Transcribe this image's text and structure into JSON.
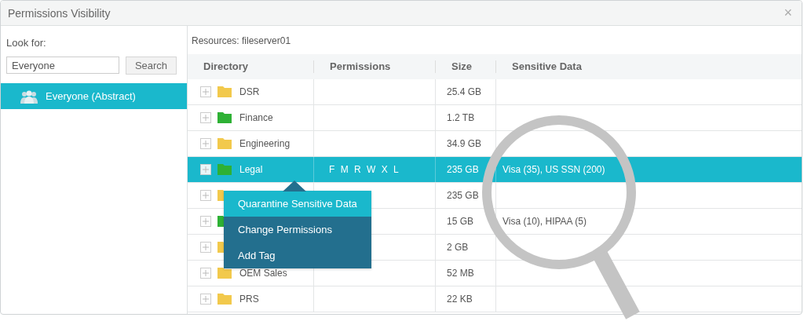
{
  "window": {
    "title": "Permissions Visibility",
    "close": "×"
  },
  "sidebar": {
    "label": "Look for:",
    "search_value": "Everyone",
    "search_button": "Search",
    "items": [
      {
        "label": "Everyone (Abstract)",
        "selected": true
      }
    ]
  },
  "resources": "Resources: fileserver01",
  "table": {
    "columns": [
      "Directory",
      "Permissions",
      "Size",
      "Sensitive Data"
    ],
    "rows": [
      {
        "name": "DSR",
        "color": "#f2c94c",
        "permissions": "",
        "size": "25.4 GB",
        "sensitive": "",
        "selected": false
      },
      {
        "name": "Finance",
        "color": "#2eb135",
        "permissions": "",
        "size": "1.2 TB",
        "sensitive": "",
        "selected": false
      },
      {
        "name": "Engineering",
        "color": "#f2c94c",
        "permissions": "",
        "size": "34.9 GB",
        "sensitive": "",
        "selected": false
      },
      {
        "name": "Legal",
        "color": "#2eb135",
        "permissions": "F M R W X L",
        "size": "235 GB",
        "sensitive": "Visa (35), US SSN (200)",
        "selected": true
      },
      {
        "name": "",
        "color": "#f2c94c",
        "permissions": "",
        "size": "235 GB",
        "sensitive": "",
        "selected": false
      },
      {
        "name": "",
        "color": "#2eb135",
        "permissions": "",
        "size": "15 GB",
        "sensitive": "Visa (10), HIPAA (5)",
        "selected": false
      },
      {
        "name": "",
        "color": "#f2c94c",
        "permissions": "",
        "size": "2 GB",
        "sensitive": "",
        "selected": false
      },
      {
        "name": "OEM Sales",
        "color": "#f2c94c",
        "permissions": "",
        "size": "52 MB",
        "sensitive": "",
        "selected": false
      },
      {
        "name": "PRS",
        "color": "#f2c94c",
        "permissions": "",
        "size": "22 KB",
        "sensitive": "",
        "selected": false
      }
    ]
  },
  "context_menu": {
    "items": [
      {
        "label": "Quarantine Sensitive Data",
        "selected": true
      },
      {
        "label": "Change Permissions",
        "selected": false
      },
      {
        "label": "Add Tag",
        "selected": false
      }
    ]
  }
}
